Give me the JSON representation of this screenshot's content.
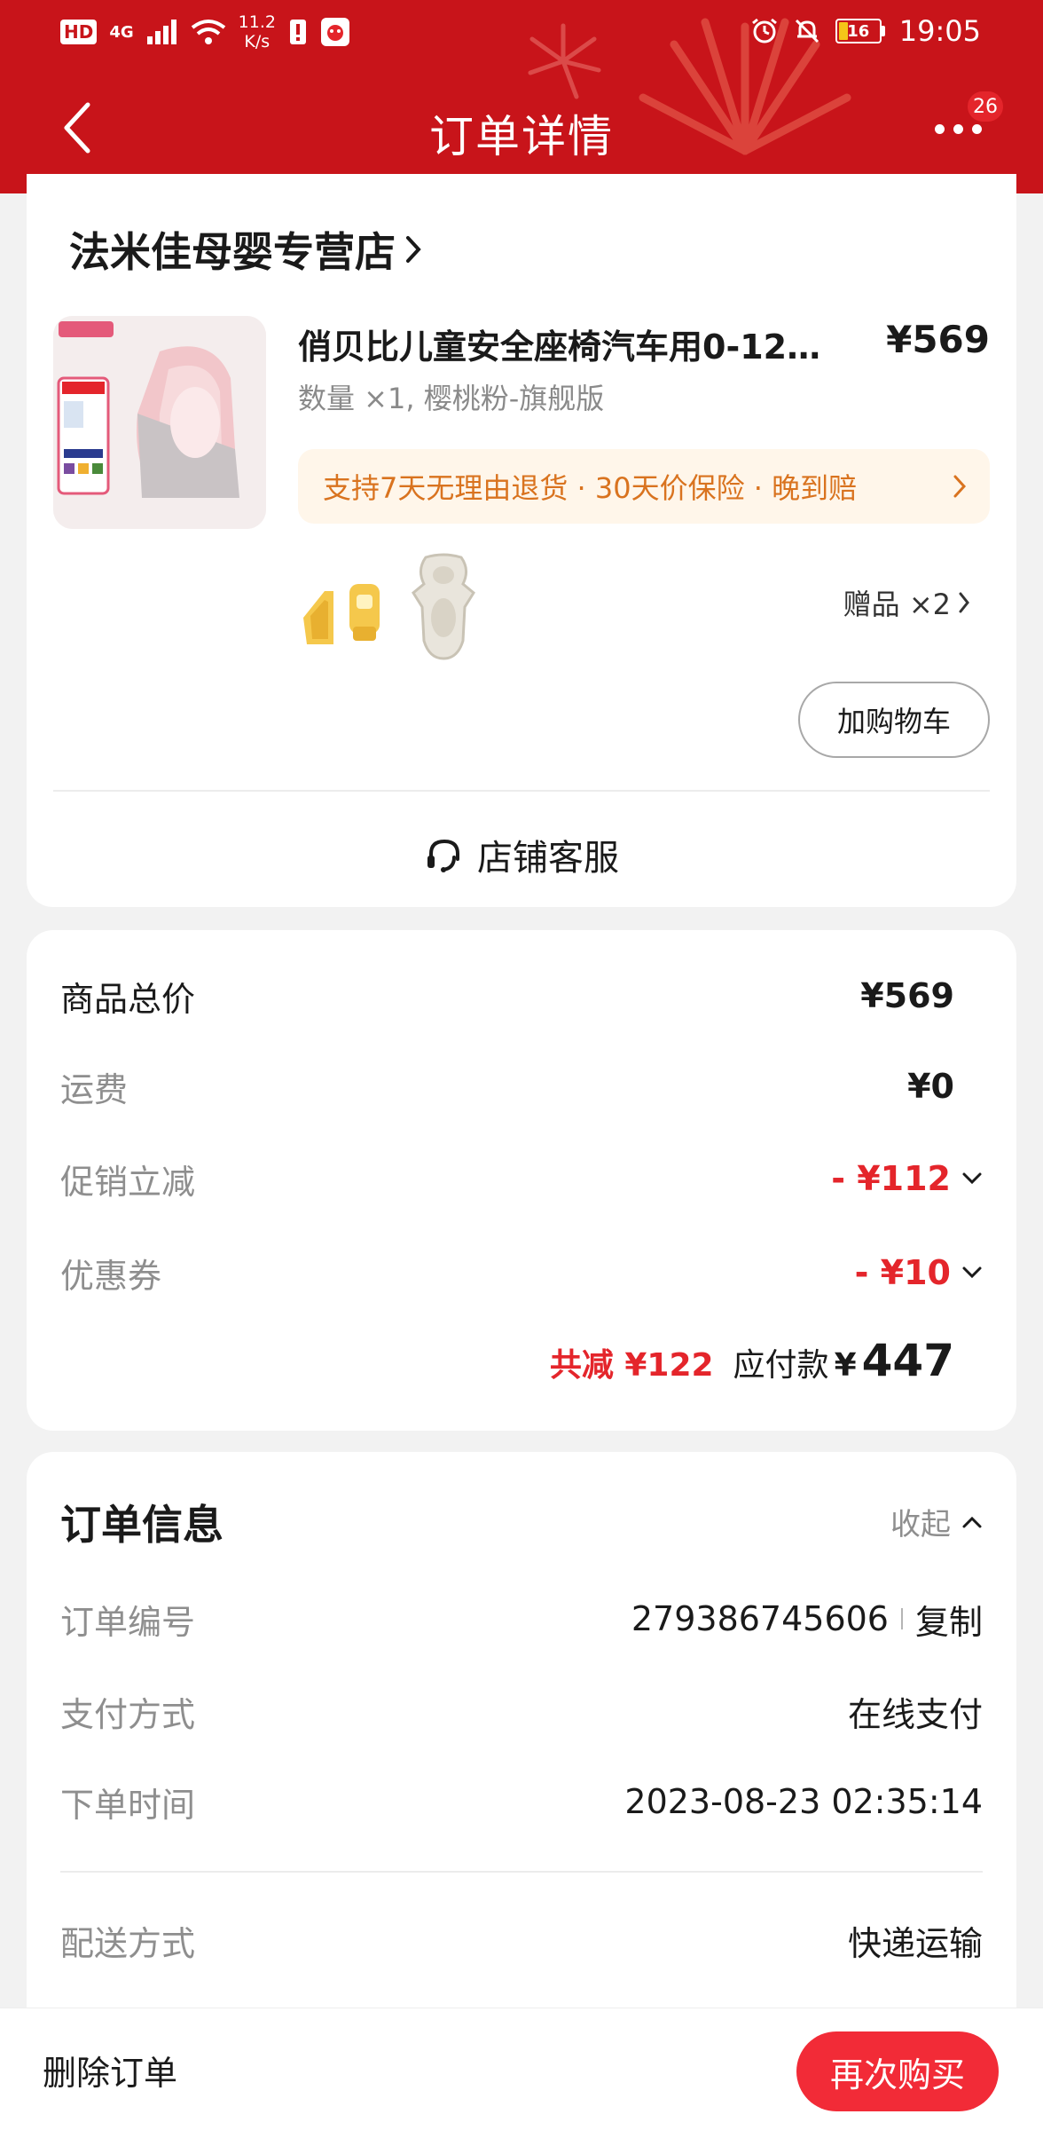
{
  "status_bar": {
    "hd": "HD",
    "network": "4G",
    "speed_value": "11.2",
    "speed_unit": "K/s",
    "battery": "16",
    "time": "19:05"
  },
  "nav": {
    "title": "订单详情",
    "more_badge": "26"
  },
  "shop": {
    "name": "法米佳母婴专营店",
    "product": {
      "title": "俏贝比儿童安全座椅汽车用0-12…",
      "price": "¥569",
      "spec": "数量 ×1, 樱桃粉-旗舰版",
      "guarantee": "支持7天无理由退货 · 30天价保险 · 晚到赔",
      "gift_label": "赠品 ×2",
      "add_cart": "加购物车"
    },
    "service": "店铺客服"
  },
  "price_summary": {
    "rows": [
      {
        "label": "商品总价",
        "value": "¥569"
      },
      {
        "label": "运费",
        "value": "¥0"
      },
      {
        "label": "促销立减",
        "value": "- ¥112"
      },
      {
        "label": "优惠券",
        "value": "- ¥10"
      }
    ],
    "total_saved": "共减 ¥122",
    "due_label": "应付款",
    "due_currency": "¥",
    "due_amount": "447"
  },
  "order_info": {
    "title": "订单信息",
    "collapse": "收起",
    "rows": [
      {
        "label": "订单编号",
        "value": "279386745606"
      },
      {
        "label": "支付方式",
        "value": "在线支付"
      },
      {
        "label": "下单时间",
        "value": "2023-08-23 02:35:14"
      },
      {
        "label": "配送方式",
        "value": "快递运输"
      }
    ],
    "copy": "复制"
  },
  "bottom_bar": {
    "delete": "删除订单",
    "rebuy": "再次购买"
  },
  "colors": {
    "header_red": "#c8141a",
    "accent_red": "#e4252b",
    "button_red": "#f22b37",
    "guarantee_orange": "#d9731f"
  }
}
